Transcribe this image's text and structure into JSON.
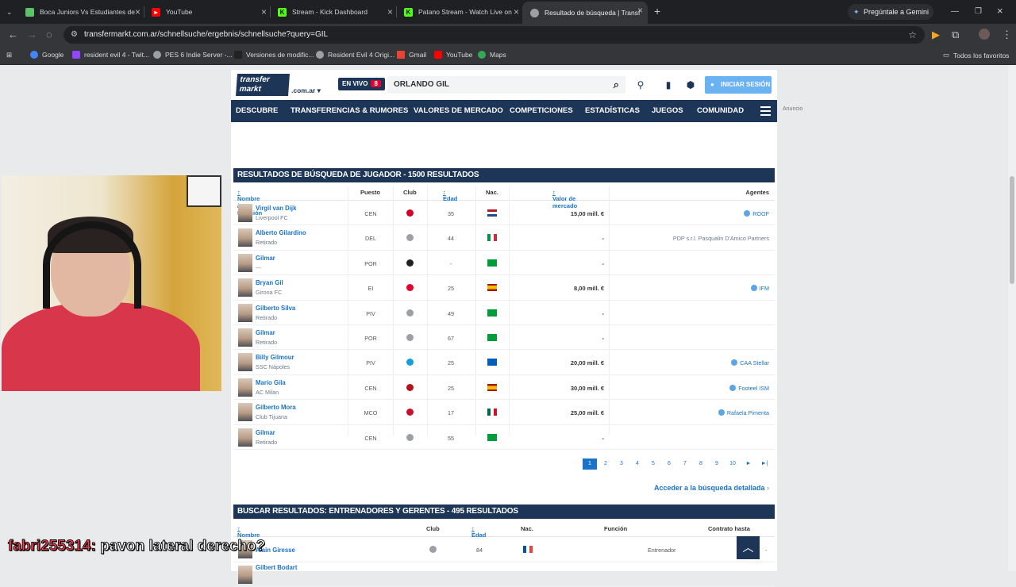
{
  "browser": {
    "tabs": [
      {
        "title": "Boca Juniors Vs Estudiantes de",
        "icon": "shield-icon",
        "color": "#5ec26a"
      },
      {
        "title": "YouTube",
        "icon": "youtube-icon",
        "color": "#ff0000"
      },
      {
        "title": "Stream - Kick Dashboard",
        "icon": "kick-icon",
        "color": "#53fc18"
      },
      {
        "title": "Patano Stream - Watch Live on",
        "icon": "kick-icon",
        "color": "#53fc18"
      },
      {
        "title": "Resultado de búsqueda | Transf",
        "icon": "globe-icon",
        "color": "#9aa0a6"
      }
    ],
    "url": "transfermarkt.com.ar/schnellsuche/ergebnis/schnellsuche?query=GIL",
    "gemini": "Pregúntale a Gemini",
    "bookmarks": [
      "Google",
      "resident evil 4 - Twit...",
      "PES 6 Indie Server -...",
      "Versiones de modific...",
      "Resident Evil 4 Origi...",
      "Gmail",
      "YouTube",
      "Maps"
    ],
    "all_bookmarks": "Todos los favoritos"
  },
  "site": {
    "logo_line1": "transfer",
    "logo_line2": "markt",
    "domain": ".com.ar",
    "live_label": "EN VIVO",
    "live_count": "8",
    "search_value": "ORLANDO GIL",
    "login_label": "INICIAR SESIÓN",
    "nav": [
      "DESCUBRE",
      "TRANSFERENCIAS & RUMORES",
      "VALORES DE MERCADO",
      "COMPETICIONES",
      "ESTADÍSTICAS",
      "JUEGOS",
      "COMUNIDAD"
    ],
    "ad_label": "Anuncio"
  },
  "players": {
    "title": "RESULTADOS DE BÚSQUEDA DE JUGADOR - 1500 RESULTADOS",
    "headers": {
      "name": "Nombre / Posición",
      "pos": "Puesto",
      "club": "Club",
      "age": "Edad",
      "nat": "Nac.",
      "value": "Valor de mercado",
      "agent": "Agentes"
    },
    "rows": [
      {
        "name": "Virgil van Dijk",
        "club": "Liverpool FC",
        "pos": "CEN",
        "age": "35",
        "value": "15,00 mill. €",
        "agent": "ROOF",
        "club_color": "#d00027",
        "flag": "netherlands"
      },
      {
        "name": "Alberto Gilardino",
        "club": "Retirado",
        "pos": "DEL",
        "age": "44",
        "value": "-",
        "agent": "PDP s.r.l. Pasqualin D'Amico Partners",
        "club_color": "#9aa0a6",
        "flag": "italy"
      },
      {
        "name": "Gilmar",
        "club": "---",
        "pos": "POR",
        "age": "-",
        "value": "-",
        "agent": "",
        "club_color": "#222222",
        "flag": "brazil"
      },
      {
        "name": "Bryan Gil",
        "club": "Girona FC",
        "pos": "EI",
        "age": "25",
        "value": "8,00 mill. €",
        "agent": "IFM",
        "club_color": "#e4002b",
        "flag": "spain"
      },
      {
        "name": "Gilberto Silva",
        "club": "Retirado",
        "pos": "PIV",
        "age": "49",
        "value": "-",
        "agent": "",
        "club_color": "#9aa0a6",
        "flag": "brazil"
      },
      {
        "name": "Gilmar",
        "club": "Retirado",
        "pos": "POR",
        "age": "67",
        "value": "-",
        "agent": "",
        "club_color": "#9aa0a6",
        "flag": "brazil"
      },
      {
        "name": "Billy Gilmour",
        "club": "SSC Nápoles",
        "pos": "PIV",
        "age": "25",
        "value": "20,00 mill. €",
        "agent": "CAA Stellar",
        "club_color": "#12a0d7",
        "flag": "scotland"
      },
      {
        "name": "Mario Gila",
        "club": "AC Milan",
        "pos": "CEN",
        "age": "25",
        "value": "30,00 mill. €",
        "agent": "Footeel ISM",
        "club_color": "#b5121b",
        "flag": "spain"
      },
      {
        "name": "Gilberto Mora",
        "club": "Club Tijuana",
        "pos": "MCO",
        "age": "17",
        "value": "25,00 mill. €",
        "agent": "Rafaela Pimenta",
        "club_color": "#c8102e",
        "flag": "mexico"
      },
      {
        "name": "Gilmar",
        "club": "Retirado",
        "pos": "CEN",
        "age": "55",
        "value": "-",
        "agent": "",
        "club_color": "#9aa0a6",
        "flag": "brazil"
      }
    ],
    "pages": [
      "1",
      "2",
      "3",
      "4",
      "5",
      "6",
      "7",
      "8",
      "9",
      "10",
      "►",
      "►|"
    ],
    "detailed_search": "Acceder a la búsqueda detallada"
  },
  "coaches": {
    "title": "BUSCAR RESULTADOS: ENTRENADORES Y GERENTES - 495 RESULTADOS",
    "headers": {
      "name": "Nombre",
      "club": "Club",
      "age": "Edad",
      "nat": "Nac.",
      "role": "Función",
      "contract": "Contrato hasta"
    },
    "rows": [
      {
        "name": "Alain Giresse",
        "age": "84",
        "role": "Entrenador",
        "contract": "-"
      },
      {
        "name": "Gilbert Bodart",
        "age": "",
        "role": "",
        "contract": ""
      }
    ]
  },
  "stream_chat": {
    "user": "fabri255314:",
    "message": "pavon lateral derecho?"
  }
}
